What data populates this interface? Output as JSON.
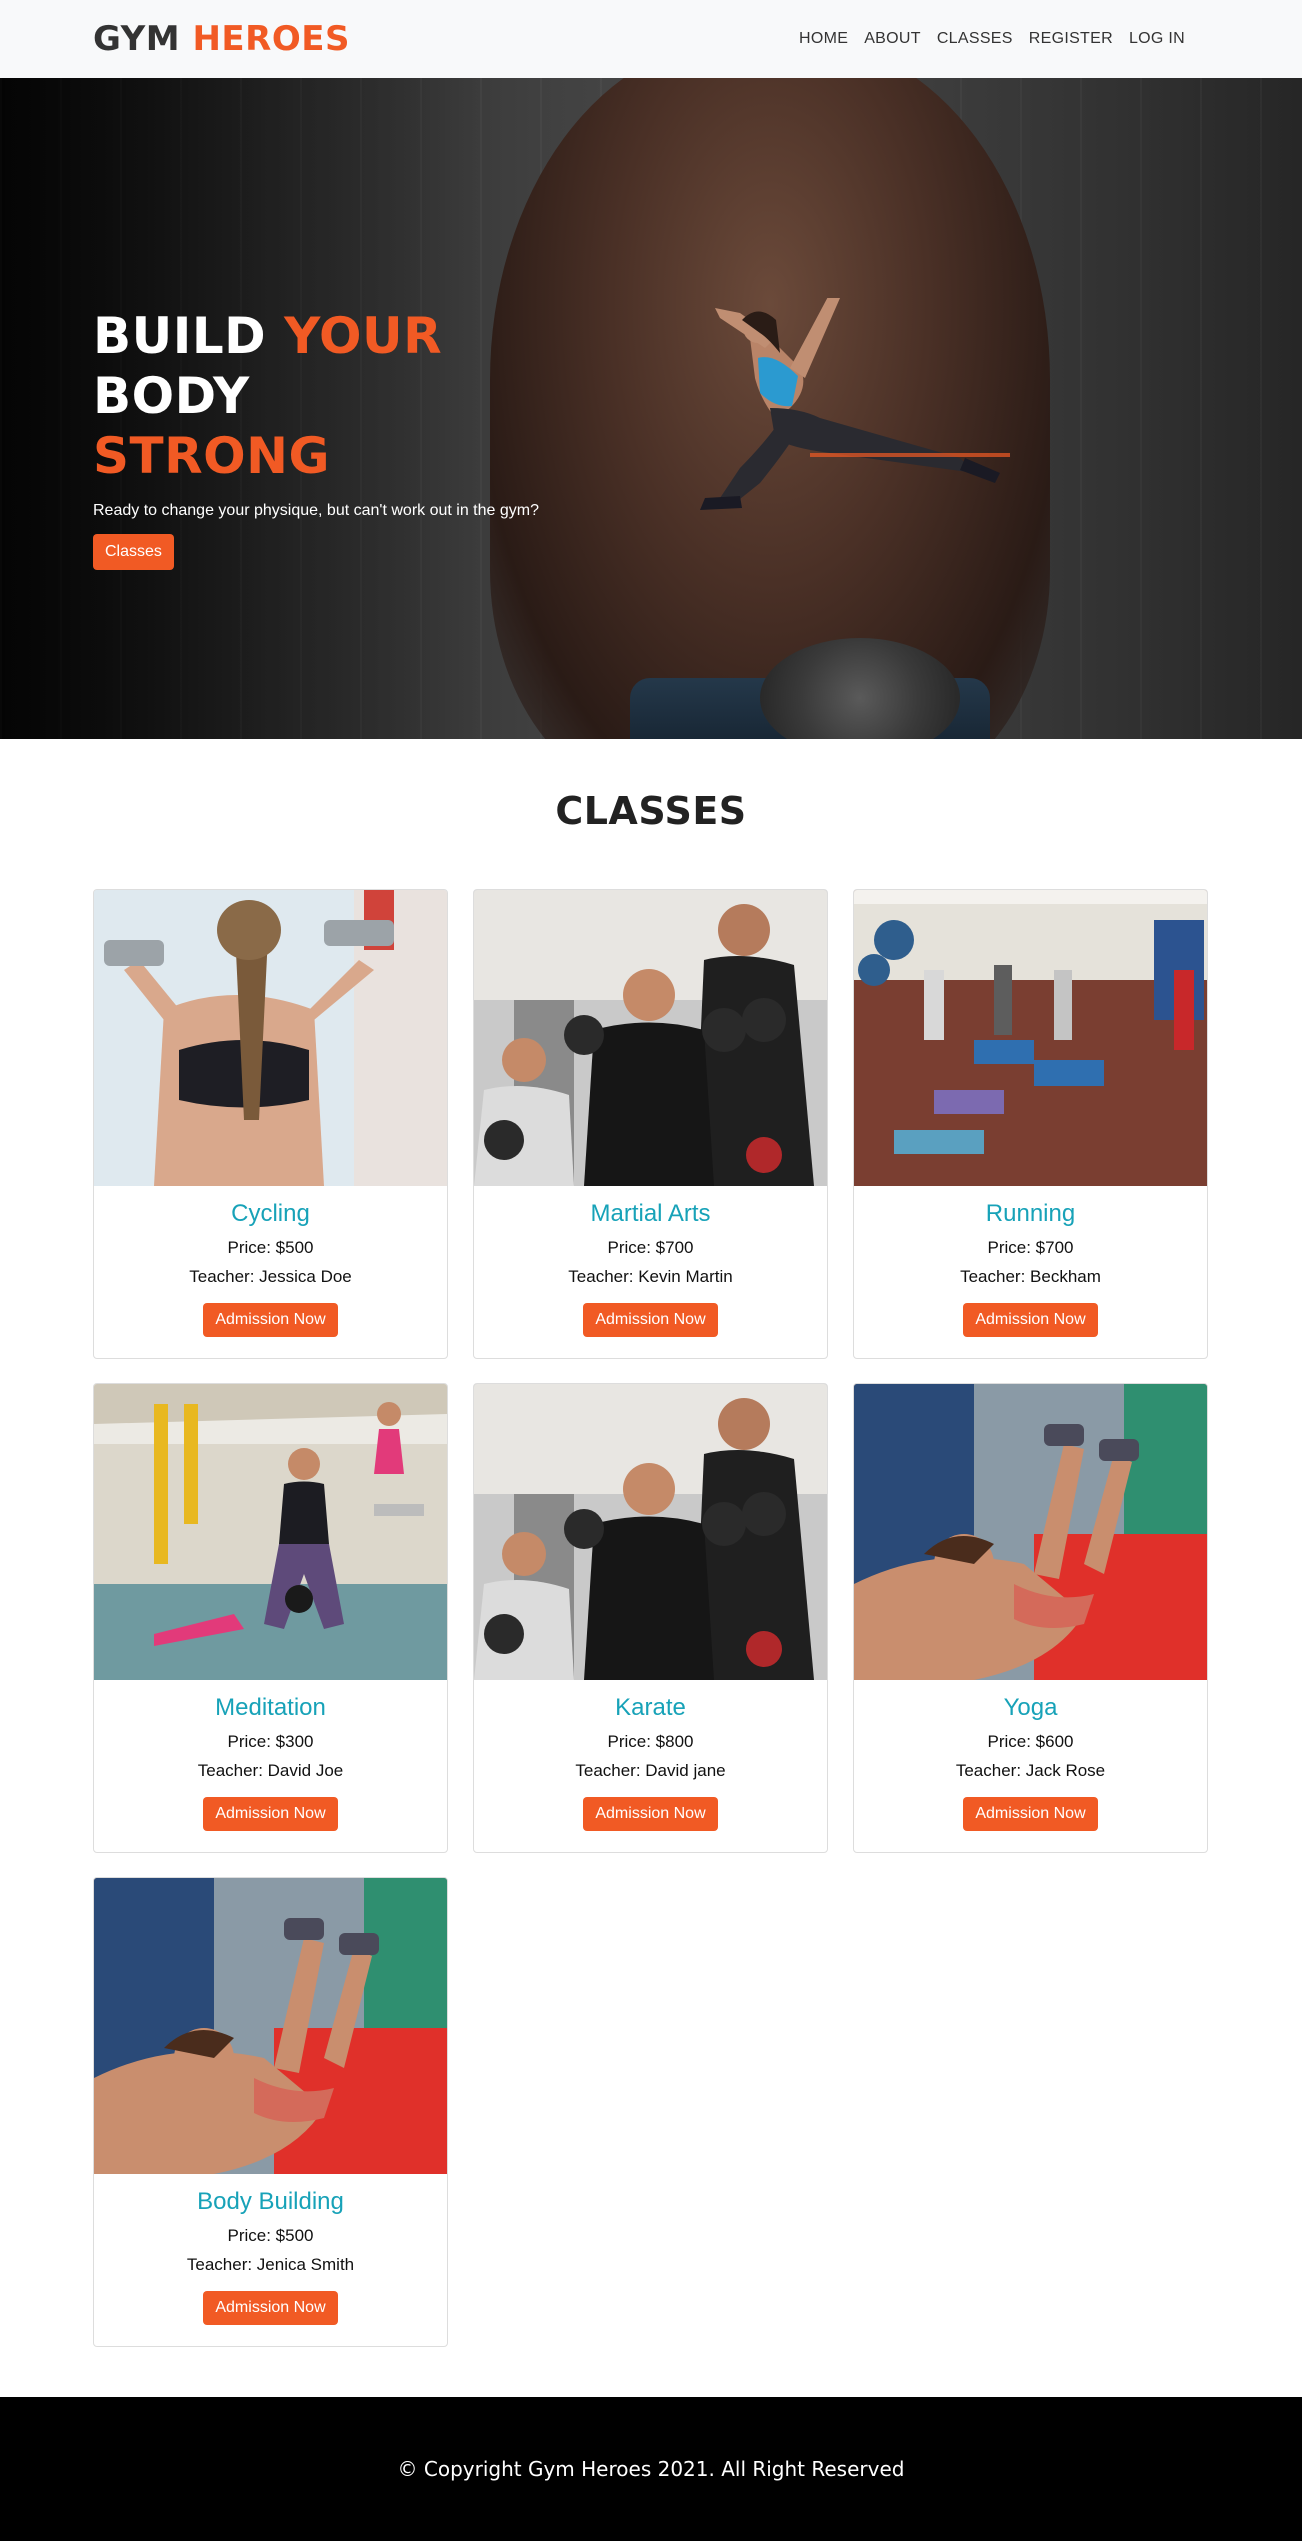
{
  "navbar": {
    "brand_part1": "GYM",
    "brand_part2": "HEROES",
    "links": [
      "HOME",
      "ABOUT",
      "CLASSES",
      "REGISTER",
      "LOG IN"
    ]
  },
  "hero": {
    "title_w1": "BUILD",
    "title_w2": "YOUR",
    "title_w3": "BODY",
    "title_w4": "STRONG",
    "subtitle": "Ready to change your physique, but can't work out in the gym?",
    "button": "Classes"
  },
  "classes_section": {
    "title": "CLASSES",
    "cards": [
      {
        "name": "Cycling",
        "price": "Price: $500",
        "teacher": "Teacher: Jessica Doe",
        "button": "Admission Now"
      },
      {
        "name": "Martial Arts",
        "price": "Price: $700",
        "teacher": "Teacher: Kevin Martin",
        "button": "Admission Now"
      },
      {
        "name": "Running",
        "price": "Price: $700",
        "teacher": "Teacher: Beckham",
        "button": "Admission Now"
      },
      {
        "name": "Meditation",
        "price": "Price: $300",
        "teacher": "Teacher: David Joe",
        "button": "Admission Now"
      },
      {
        "name": "Karate",
        "price": "Price: $800",
        "teacher": "Teacher: David jane",
        "button": "Admission Now"
      },
      {
        "name": "Yoga",
        "price": "Price: $600",
        "teacher": "Teacher: Jack Rose",
        "button": "Admission Now"
      },
      {
        "name": "Body Building",
        "price": "Price: $500",
        "teacher": "Teacher: Jenica Smith",
        "button": "Admission Now"
      }
    ]
  },
  "footer": {
    "text": "© Copyright Gym Heroes 2021. All Right Reserved"
  },
  "colors": {
    "accent": "#f15a24",
    "card_title": "#17a2b8",
    "navbar_bg": "#f8f9fa",
    "footer_bg": "#000000"
  }
}
